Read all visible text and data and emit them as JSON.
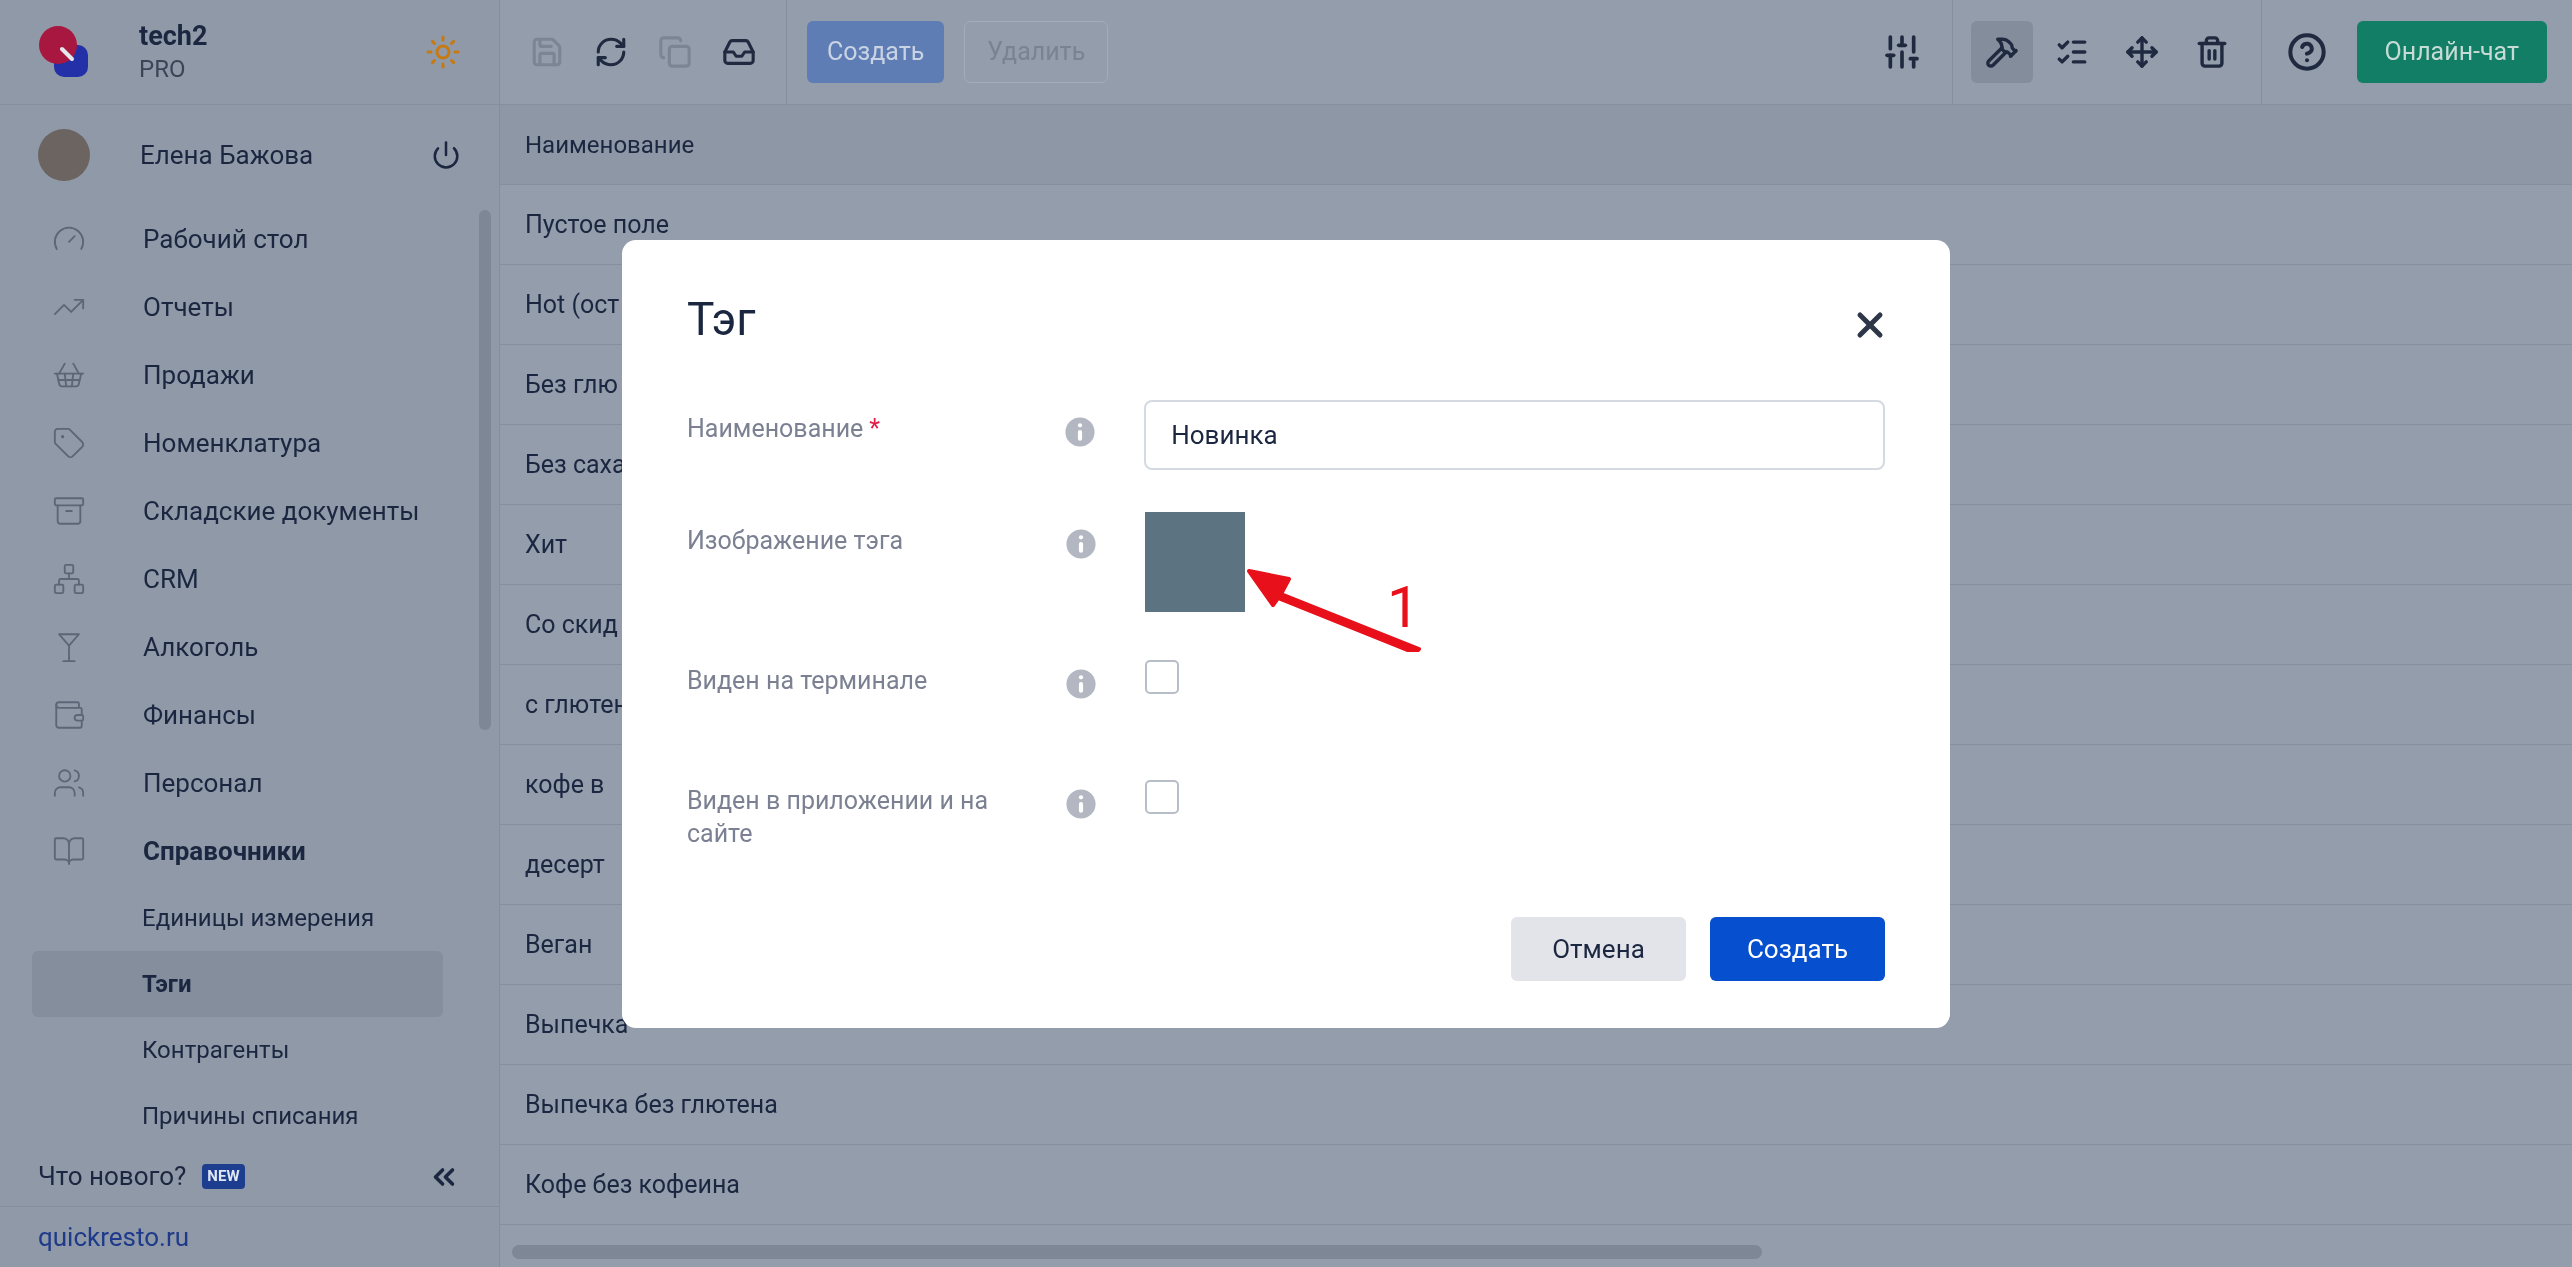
{
  "app": {
    "name": "tech2",
    "plan": "PRO"
  },
  "user": {
    "name": "Елена Бажова"
  },
  "nav": [
    {
      "label": "Рабочий стол",
      "expanded": false
    },
    {
      "label": "Отчеты",
      "expanded": false
    },
    {
      "label": "Продажи",
      "expanded": false
    },
    {
      "label": "Номенклатура",
      "expanded": false
    },
    {
      "label": "Складские документы",
      "expanded": false
    },
    {
      "label": "CRM",
      "expanded": false
    },
    {
      "label": "Алкоголь",
      "expanded": false
    },
    {
      "label": "Финансы",
      "expanded": false
    },
    {
      "label": "Персонал",
      "expanded": false
    },
    {
      "label": "Справочники",
      "expanded": true,
      "children": [
        {
          "label": "Единицы измерения",
          "selected": false
        },
        {
          "label": "Тэги",
          "selected": true
        },
        {
          "label": "Контрагенты",
          "selected": false
        },
        {
          "label": "Причины списания",
          "selected": false
        }
      ]
    }
  ],
  "whats_new": {
    "label": "Что нового?",
    "badge": "NEW"
  },
  "site_link": "quickresto.ru",
  "toolbar": {
    "icon_buttons": [
      {
        "disabled": true
      },
      {
        "disabled": false
      },
      {
        "disabled": true
      },
      {
        "disabled": false
      }
    ],
    "create": "Создать",
    "delete": {
      "label": "Удалить",
      "disabled": true
    },
    "tools": [
      {
        "selected": true
      },
      {
        "selected": false
      },
      {
        "selected": false
      },
      {
        "selected": false
      }
    ],
    "chat": "Онлайн-чат"
  },
  "table": {
    "columns": [
      "Наименование"
    ],
    "rows": [
      "Пустое поле",
      "Hot (ост",
      "Без глю",
      "Без саха",
      "Хит",
      "Со скид",
      "с глютен",
      "кофе в",
      "десерт",
      "Веган",
      "Выпечка",
      "Выпечка без глютена",
      "Кофе без кофеина"
    ]
  },
  "dialog": {
    "title": "Тэг",
    "fields": [
      {
        "kind": "text",
        "label": "Наименование",
        "required_mark": "*",
        "value": "Новинка"
      },
      {
        "kind": "color",
        "label": "Изображение тэга",
        "color": "#5c7482"
      },
      {
        "kind": "checkbox",
        "label": "Виден на терминале",
        "checked": false
      },
      {
        "kind": "checkbox",
        "label": "Виден в приложении и на сайте",
        "checked": false
      }
    ],
    "buttons": [
      {
        "label": "Отмена",
        "kind": "secondary"
      },
      {
        "label": "Создать",
        "kind": "primary"
      }
    ],
    "annotation": "1"
  }
}
